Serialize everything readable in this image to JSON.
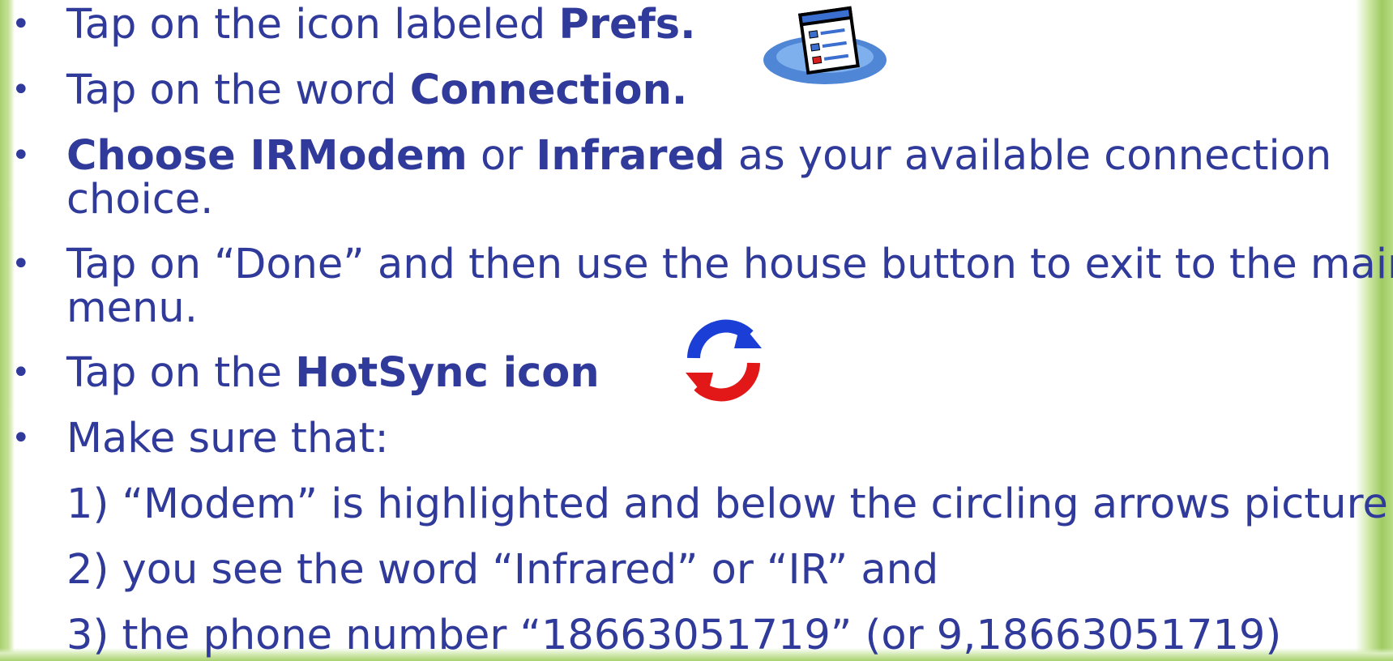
{
  "bullets": [
    {
      "plain": "Tap on the icon labeled ",
      "bold": "Prefs."
    },
    {
      "plain": "Tap on the word ",
      "bold": "Connection."
    },
    {
      "bold1": "Choose IRModem",
      "mid": " or ",
      "bold2": "Infrared",
      "tail": " as your available connection",
      "line2": "choice."
    },
    {
      "line1": "Tap on “Done” and then use the house button to exit to the main",
      "line2": "menu."
    },
    {
      "plain": "Tap on the ",
      "bold": "HotSync icon"
    },
    {
      "plain": "Make sure that:"
    }
  ],
  "subitems": [
    "1) “Modem” is highlighted and below the circling arrows picture",
    "2) you see the word “Infrared” or “IR” and",
    "3) the phone number “18663051719” (or 9,18663051719)"
  ],
  "bullet_char": "•",
  "icons": {
    "prefs": "prefs-icon",
    "hotsync": "hotsync-icon"
  },
  "colors": {
    "text": "#303a9a",
    "accent_green": "#a8cf6f"
  }
}
